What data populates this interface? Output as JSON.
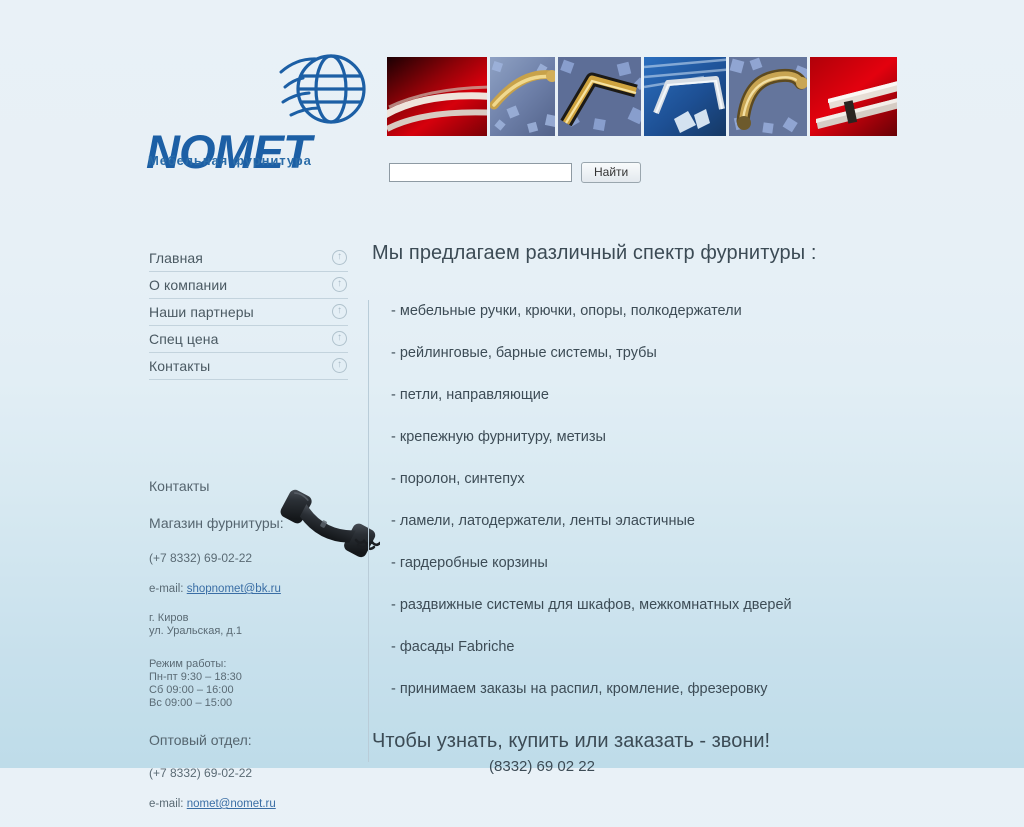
{
  "site": {
    "logo_word": "NOMET",
    "logo_tagline": "Мебельная фурнитура",
    "globe_icon": "globe-icon",
    "brand_color": "#1c5fa5",
    "link_color": "#3a6ea5",
    "background_top": "#e9f1f7",
    "background_bottom": "#bedce9"
  },
  "banner": {
    "name": "product-banner",
    "images": [
      {
        "alt": "white-handle-on-red",
        "style": "red"
      },
      {
        "alt": "brass-bow-handle-on-blue-gravel",
        "style": "blue"
      },
      {
        "alt": "gold-angular-handle-on-blue-gravel",
        "style": "blue"
      },
      {
        "alt": "chrome-handle-on-blue-ice",
        "style": "ice"
      },
      {
        "alt": "antique-brass-handle-on-blue-gravel",
        "style": "blue"
      },
      {
        "alt": "steel-bar-handle-on-red",
        "style": "red"
      }
    ]
  },
  "search": {
    "value": "",
    "placeholder": "",
    "button_label": "Найти"
  },
  "nav": {
    "items": [
      {
        "label": "Главная",
        "icon": "circle-arrow-up-icon"
      },
      {
        "label": "О компании",
        "icon": "circle-arrow-up-icon"
      },
      {
        "label": "Наши партнеры",
        "icon": "circle-arrow-up-icon"
      },
      {
        "label": "Спец цена",
        "icon": "circle-arrow-up-icon"
      },
      {
        "label": "Контакты",
        "icon": "circle-arrow-up-icon"
      }
    ]
  },
  "contacts": {
    "heading": "Контакты",
    "shop_label": "Магазин фурнитуры:",
    "shop_phone": "(+7 8332) 69-02-22",
    "email_label": "e-mail:",
    "shop_email": "shopnomet@bk.ru",
    "address": "г. Киров\nул. Уральская, д.1",
    "hours": "Режим работы:\nПн-пт 9:30 – 18:30\nСб 09:00 – 16:00\nВс 09:00 – 15:00",
    "wholesale_label": "Оптовый отдел:",
    "wholesale_phone": "(+7 8332) 69-02-22",
    "wholesale_email_label": "e-mail:",
    "wholesale_email": "nomet@nomet.ru",
    "handset_icon": "telephone-handset-icon"
  },
  "main": {
    "title": "Мы предлагаем различный спектр фурнитуры :",
    "items": [
      "- мебельные ручки, крючки, опоры, полкодержатели",
      "- рейлинговые, барные системы, трубы",
      "- петли, направляющие",
      "- крепежную фурнитуру, метизы",
      "- поролон, синтепух",
      "- ламели, латодержатели, ленты эластичные",
      "- гардеробные корзины",
      "- раздвижные системы для шкафов, межкомнатных дверей",
      "- фасады Fabriche",
      "- принимаем заказы на распил, кромление, фрезеровку"
    ],
    "cta_text": "Чтобы узнать, купить или заказать - звони!",
    "cta_phone": "(8332) 69 02 22"
  }
}
